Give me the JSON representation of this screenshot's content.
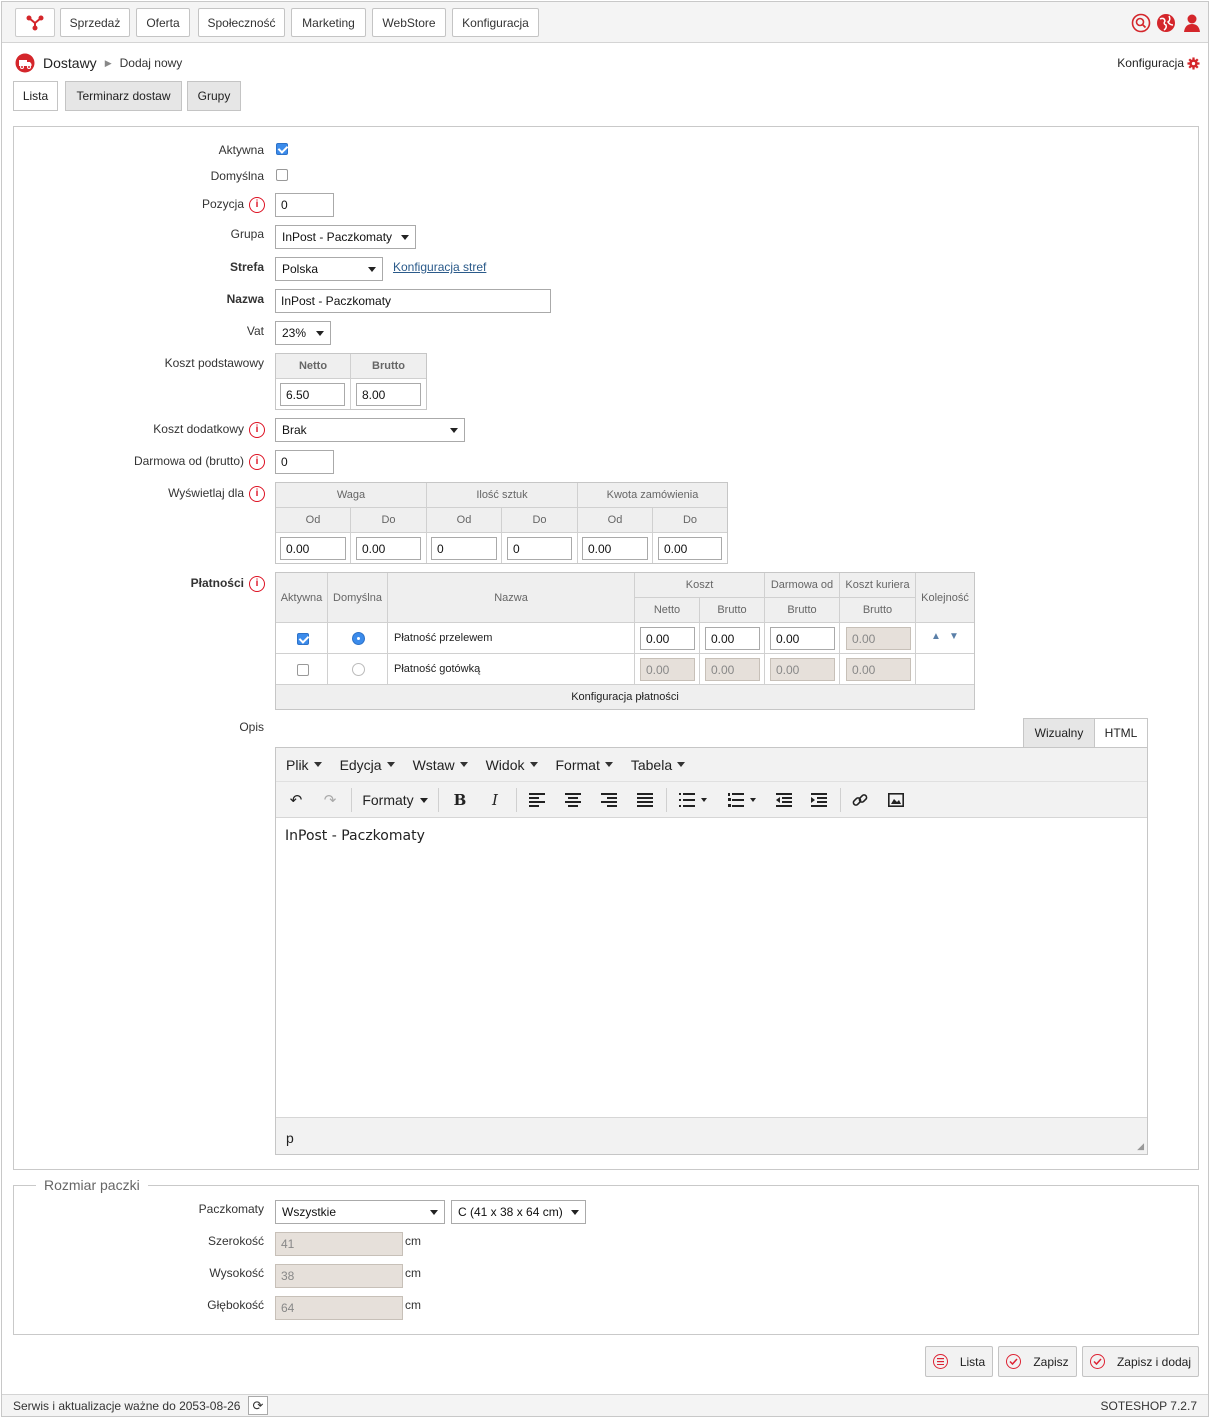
{
  "topnav": {
    "items": [
      "Sprzedaż",
      "Oferta",
      "Społeczność",
      "Marketing",
      "WebStore",
      "Konfiguracja"
    ],
    "icons": [
      "search-icon",
      "globe-icon",
      "user-icon"
    ],
    "accent": "#d4262b"
  },
  "breadcrumb": {
    "section": "Dostawy",
    "page": "Dodaj nowy"
  },
  "config_link": "Konfiguracja",
  "tabs": [
    "Lista",
    "Terminarz dostaw",
    "Grupy"
  ],
  "form": {
    "aktywna": {
      "label": "Aktywna",
      "checked": true
    },
    "domyslna": {
      "label": "Domyślna",
      "checked": false
    },
    "pozycja": {
      "label": "Pozycja",
      "value": "0"
    },
    "grupa": {
      "label": "Grupa",
      "value": "InPost - Paczkomaty"
    },
    "strefa": {
      "label": "Strefa",
      "value": "Polska",
      "link": "Konfiguracja stref"
    },
    "nazwa": {
      "label": "Nazwa",
      "value": "InPost - Paczkomaty"
    },
    "vat": {
      "label": "Vat",
      "value": "23%"
    },
    "koszt_podstawowy": {
      "label": "Koszt podstawowy",
      "h_netto": "Netto",
      "h_brutto": "Brutto",
      "netto": "6.50",
      "brutto": "8.00"
    },
    "koszt_dodatkowy": {
      "label": "Koszt dodatkowy",
      "value": "Brak"
    },
    "darmowa_od": {
      "label": "Darmowa od (brutto)",
      "value": "0"
    },
    "wyswietlaj_dla": {
      "label": "Wyświetlaj dla",
      "groups": [
        "Waga",
        "Ilość sztuk",
        "Kwota zamówienia"
      ],
      "sub": [
        "Od",
        "Do",
        "Od",
        "Do",
        "Od",
        "Do"
      ],
      "values": [
        "0.00",
        "0.00",
        "0",
        "0",
        "0.00",
        "0.00"
      ]
    },
    "platnosci": {
      "label": "Płatności",
      "headers": {
        "aktywna": "Aktywna",
        "domyslna": "Domyślna",
        "nazwa": "Nazwa",
        "koszt": "Koszt",
        "darmowa_od": "Darmowa od",
        "koszt_kuriera": "Koszt kuriera",
        "kolejnosc": "Kolejność",
        "netto": "Netto",
        "brutto": "Brutto",
        "brutto2": "Brutto",
        "brutto3": "Brutto"
      },
      "rows": [
        {
          "name": "Płatność przelewem",
          "active": true,
          "default": true,
          "netto": "0.00",
          "brutto": "0.00",
          "darmowa": "0.00",
          "kurier": "0.00"
        },
        {
          "name": "Płatność gotówką",
          "active": false,
          "default": false,
          "netto": "0.00",
          "brutto": "0.00",
          "darmowa": "0.00",
          "kurier": "0.00"
        }
      ],
      "footer": "Konfiguracja płatności"
    },
    "opis": {
      "label": "Opis",
      "tab_visual": "Wizualny",
      "tab_html": "HTML",
      "menu": [
        "Plik",
        "Edycja",
        "Wstaw",
        "Widok",
        "Format",
        "Tabela"
      ],
      "formats": "Formaty",
      "content": "InPost - Paczkomaty",
      "path": "p"
    }
  },
  "rozmiar": {
    "legend": "Rozmiar paczki",
    "paczkomaty": {
      "label": "Paczkomaty",
      "value": "Wszystkie",
      "size": "C (41 x 38 x 64 cm)"
    },
    "szerokosc": {
      "label": "Szerokość",
      "value": "41",
      "unit": "cm"
    },
    "wysokosc": {
      "label": "Wysokość",
      "value": "38",
      "unit": "cm"
    },
    "glebokosc": {
      "label": "Głębokość",
      "value": "64",
      "unit": "cm"
    }
  },
  "actions": {
    "lista": "Lista",
    "zapisz": "Zapisz",
    "zapisz_dodaj": "Zapisz i dodaj"
  },
  "footer": {
    "service": "Serwis i aktualizacje ważne do 2053-08-26",
    "version": "SOTESHOP 7.2.7"
  }
}
